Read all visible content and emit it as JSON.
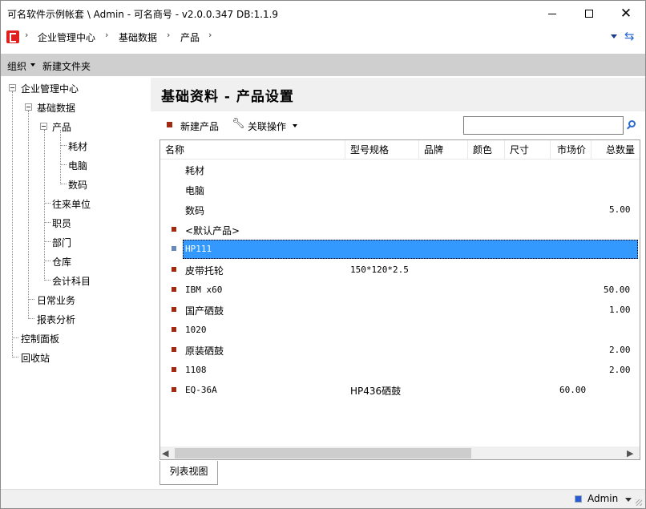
{
  "window": {
    "title": "可名软件示例帐套 \\ Admin - 可名商号 - v2.0.0.347  DB:1.1.9"
  },
  "breadcrumb": [
    "企业管理中心",
    "基础数据",
    "产品"
  ],
  "toolbar": {
    "organize": "组织",
    "new_folder": "新建文件夹"
  },
  "tree": {
    "root": "企业管理中心",
    "basic": "基础数据",
    "product": "产品",
    "product_children": [
      "耗材",
      "电脑",
      "数码"
    ],
    "basic_children": [
      "往来单位",
      "职员",
      "部门",
      "仓库",
      "会计科目"
    ],
    "daily": "日常业务",
    "reports": "报表分析",
    "control_panel": "控制面板",
    "recycle": "回收站"
  },
  "main": {
    "title": "基础资料 - 产品设置",
    "new_product": "新建产品",
    "related_ops": "关联操作",
    "search_value": ""
  },
  "grid": {
    "columns": [
      "名称",
      "型号规格",
      "品牌",
      "颜色",
      "尺寸",
      "市场价",
      "总数量"
    ],
    "rows": [
      {
        "type": "folder",
        "name": "耗材",
        "spec": "",
        "price": "",
        "qty": ""
      },
      {
        "type": "folder",
        "name": "电脑",
        "spec": "",
        "price": "",
        "qty": ""
      },
      {
        "type": "folder",
        "name": "数码",
        "spec": "",
        "price": "",
        "qty": "5.00"
      },
      {
        "type": "item",
        "name": "<默认产品>",
        "spec": "",
        "price": "",
        "qty": ""
      },
      {
        "type": "selected",
        "name": "HP111",
        "spec": "",
        "price": "",
        "qty": ""
      },
      {
        "type": "item",
        "name": "皮带托轮",
        "spec": "150*120*2.5",
        "price": "",
        "qty": ""
      },
      {
        "type": "item",
        "name": "IBM x60",
        "spec": "",
        "price": "",
        "qty": "50.00"
      },
      {
        "type": "item",
        "name": "国产硒鼓",
        "spec": "",
        "price": "",
        "qty": "1.00"
      },
      {
        "type": "item",
        "name": "1020",
        "spec": "",
        "price": "",
        "qty": ""
      },
      {
        "type": "item",
        "name": "原装硒鼓",
        "spec": "",
        "price": "",
        "qty": "2.00"
      },
      {
        "type": "item",
        "name": "1108",
        "spec": "",
        "price": "",
        "qty": "2.00"
      },
      {
        "type": "item",
        "name": "EQ-36A",
        "spec": "HP436硒鼓",
        "price": "60.00",
        "qty": ""
      }
    ]
  },
  "tabs": {
    "list_view": "列表视图"
  },
  "status": {
    "user": "Admin"
  },
  "colors": {
    "marker": "#a12b12",
    "selection": "#3399ff",
    "toolbar_bg": "#cfcfcf"
  }
}
